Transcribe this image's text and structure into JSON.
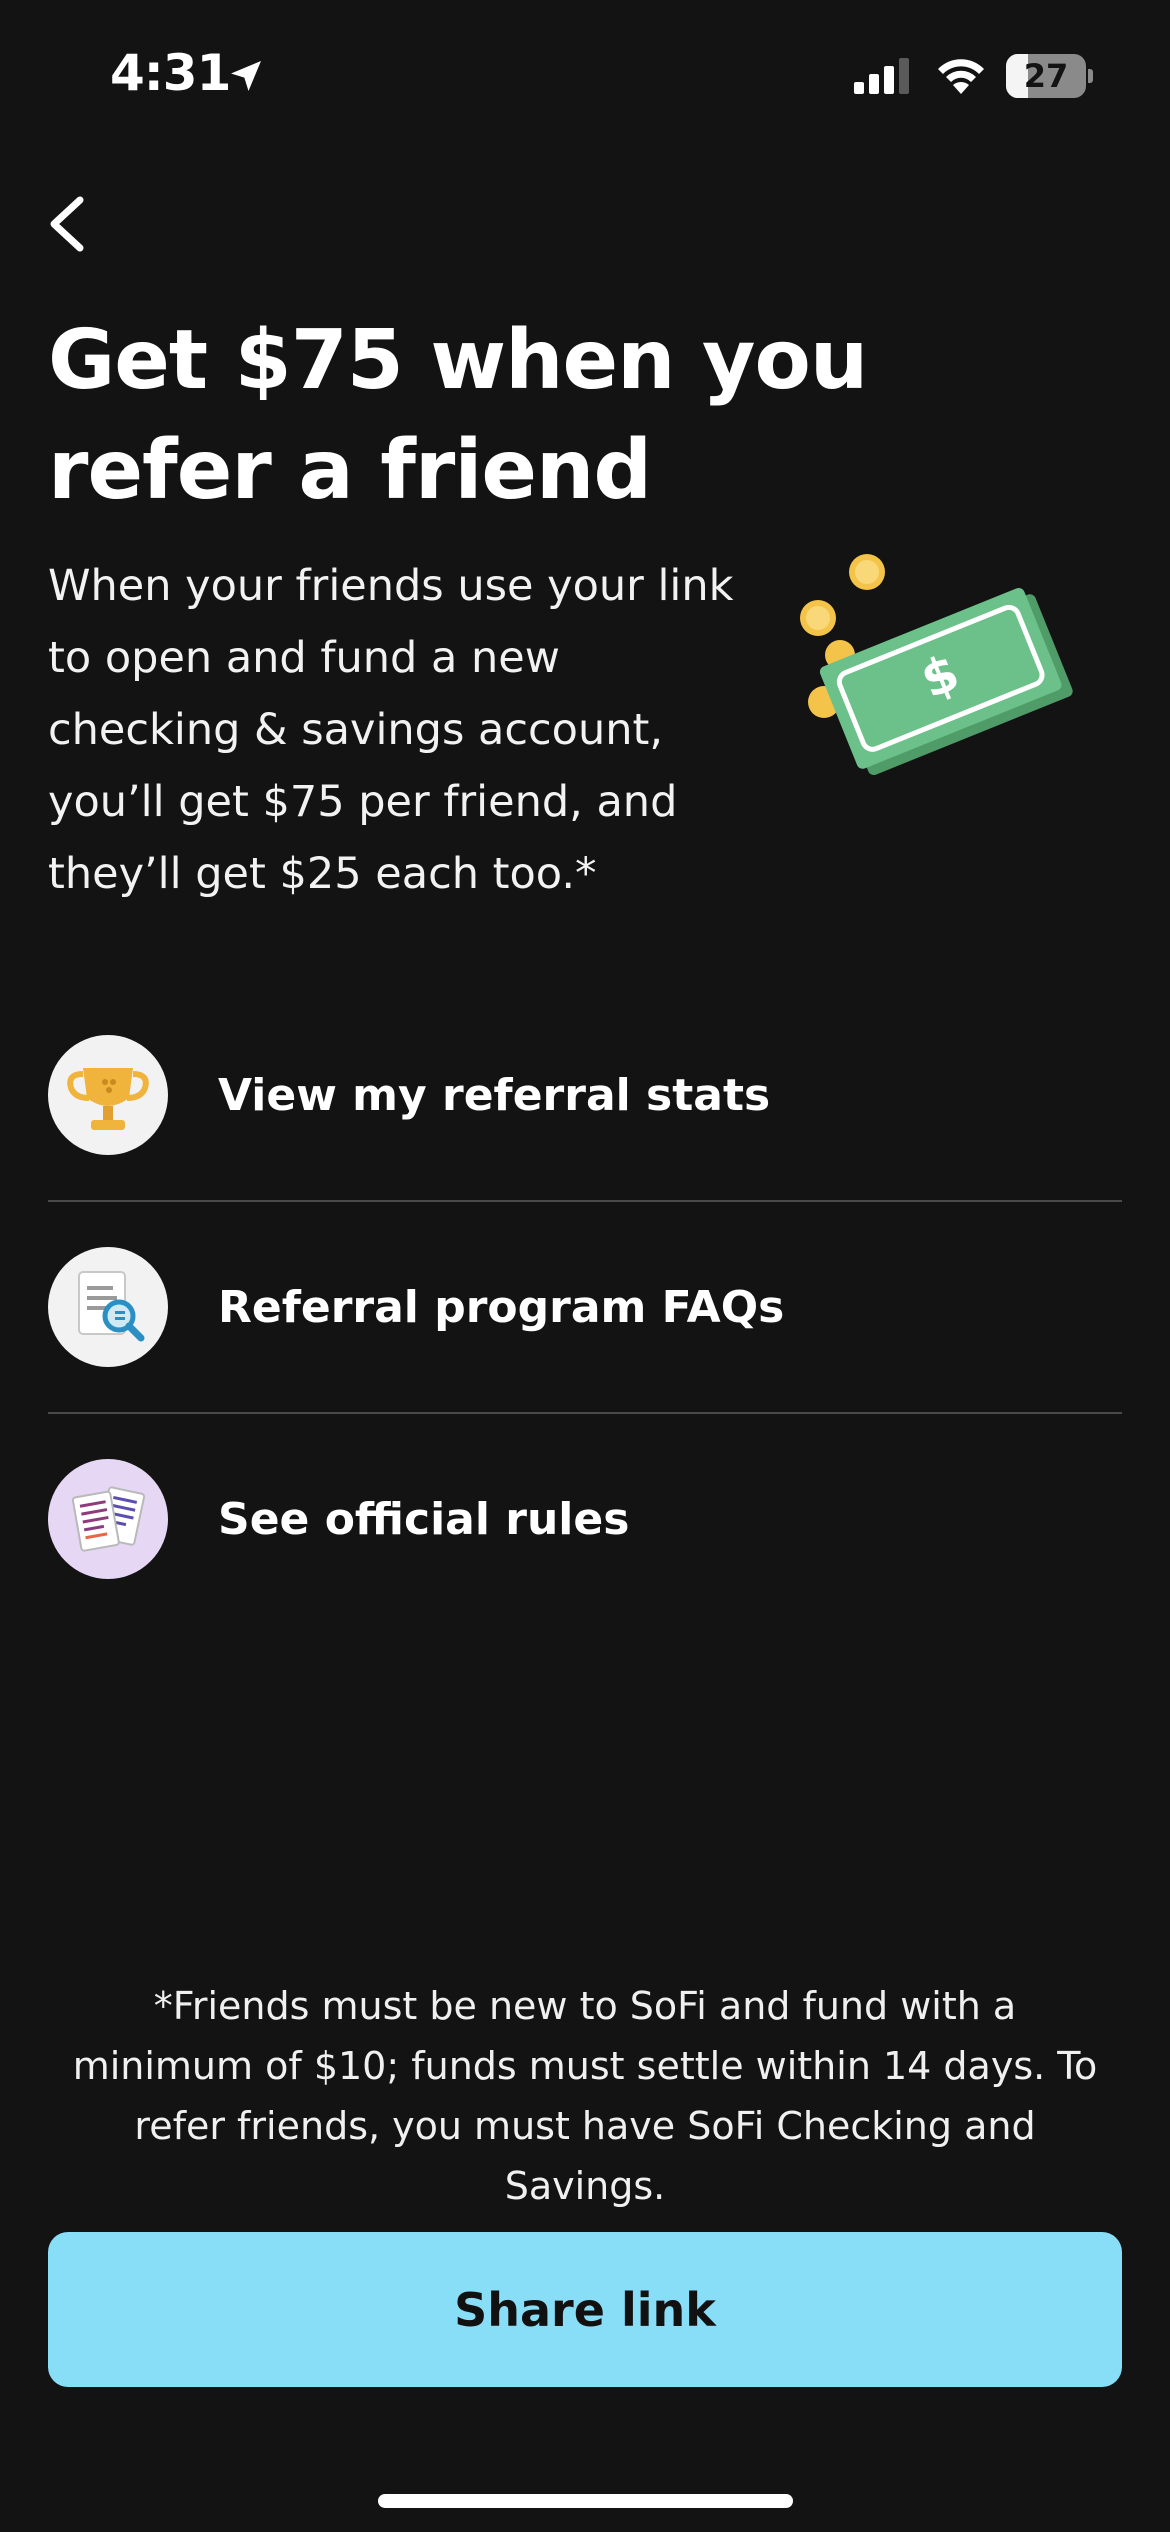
{
  "status_bar": {
    "time": "4:31",
    "battery_level": "27",
    "battery_fraction": 0.27
  },
  "header": {
    "title": "Get $75 when you refer a friend"
  },
  "description": "When your friends use your link to open and fund a new checking & savings account, you’ll get $75 per friend, and they’ll get $25 each too.*",
  "menu": {
    "items": [
      {
        "label": "View my referral stats",
        "icon": "trophy-icon"
      },
      {
        "label": "Referral program FAQs",
        "icon": "document-search-icon"
      },
      {
        "label": "See official rules",
        "icon": "rules-papers-icon"
      }
    ]
  },
  "disclaimer": "*Friends must be new to SoFi and fund with a minimum of $10; funds must settle within 14 days. To refer friends, you must have SoFi Checking and Savings.",
  "share_button": {
    "label": "Share link"
  },
  "colors": {
    "background": "#131313",
    "accent_button": "#88ddf7",
    "bill_green": "#5bb37a"
  }
}
